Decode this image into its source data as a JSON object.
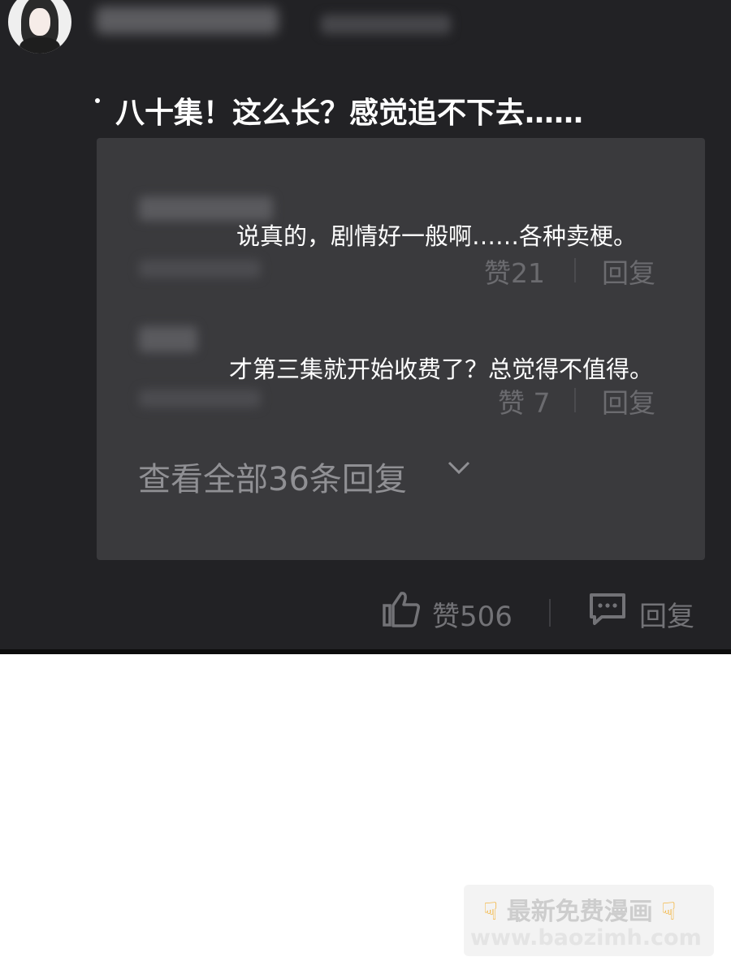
{
  "comment": {
    "text": "八十集！这么长？感觉追不下去……",
    "like_label": "赞506",
    "reply_label": "回复"
  },
  "replies": [
    {
      "text": "说真的，剧情好一般啊……各种卖梗。",
      "like_label": "赞21",
      "reply_label": "回复"
    },
    {
      "text": "才第三集就开始收费了？总觉得不值得。",
      "like_label": "赞 7",
      "reply_label": "回复"
    }
  ],
  "view_all_label": "查看全部36条回复",
  "icons": {
    "avatar": "avatar-woman",
    "chevron": "chevron-down-icon",
    "thumb": "thumbs-up-icon",
    "reply": "comment-icon"
  },
  "watermark": {
    "line1": "最新免费漫画",
    "line2": "www.baozimh.com"
  },
  "colors": {
    "background": "#222225",
    "reply_box": "#3a3a3d",
    "text_primary": "#ffffff",
    "text_muted": "#737377"
  }
}
